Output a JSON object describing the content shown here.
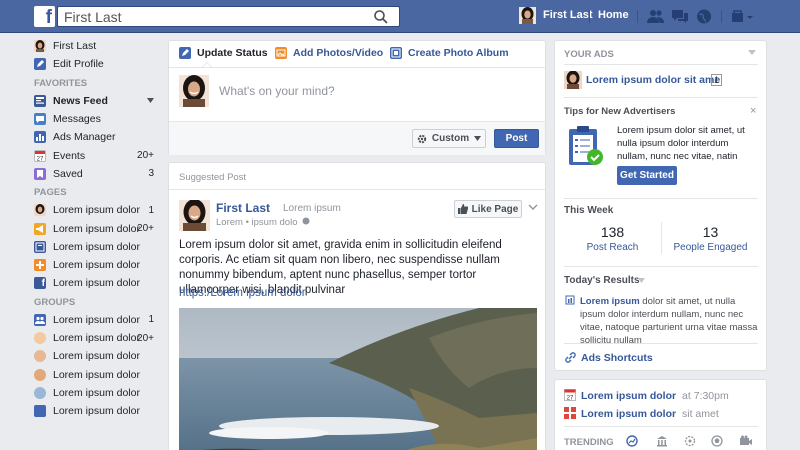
{
  "topbar": {
    "search_placeholder": "First Last",
    "user_name": "First Last",
    "home_label": "Home",
    "icons": [
      "friend-requests-icon",
      "messages-icon",
      "notifications-globe-icon",
      "settings-icon"
    ]
  },
  "left": {
    "profile": {
      "name": "First Last",
      "edit": "Edit Profile"
    },
    "favorites_heading": "FAVORITES",
    "favorites": [
      {
        "label": "News Feed",
        "count": ""
      },
      {
        "label": "Messages",
        "count": ""
      },
      {
        "label": "Ads Manager",
        "count": ""
      },
      {
        "label": "Events",
        "count": "20+"
      },
      {
        "label": "Saved",
        "count": "3"
      }
    ],
    "pages_heading": "PAGES",
    "pages": [
      {
        "label": "Lorem ipsum dolor",
        "count": "1"
      },
      {
        "label": "Lorem ipsum dolor",
        "count": "20+"
      },
      {
        "label": "Lorem ipsum dolor",
        "count": ""
      },
      {
        "label": "Lorem ipsum dolor",
        "count": ""
      },
      {
        "label": "Lorem ipsum dolor",
        "count": ""
      }
    ],
    "groups_heading": "GROUPS",
    "groups": [
      {
        "label": "Lorem ipsum dolor",
        "count": "1"
      },
      {
        "label": "Lorem ipsum dolor",
        "count": "20+"
      },
      {
        "label": "Lorem ipsum dolor",
        "count": ""
      },
      {
        "label": "Lorem ipsum dolor",
        "count": ""
      },
      {
        "label": "Lorem ipsum dolor",
        "count": ""
      },
      {
        "label": "Lorem ipsum dolor",
        "count": ""
      }
    ]
  },
  "composer": {
    "tab_status": "Update Status",
    "tab_photo": "Add Photos/Video",
    "tab_album": "Create Photo Album",
    "placeholder": "What's on your mind?",
    "audience": "Custom",
    "post": "Post"
  },
  "post": {
    "label": "Suggested Post",
    "name": "First Last",
    "handle": "Lorem ipsum",
    "meta": "Lorem • ipsum dolo",
    "like_page": "Like Page",
    "text": "Lorem ipsum dolor sit amet, gravida enim in sollicitudin eleifend corporis. Ac etiam sit quam non libero, nec suspendisse nullam nonummy bibendum, aptent nunc phasellus, semper tortor ullamcorper wisi, blandit pulvinar",
    "link": "https:/Lorem ipsum dolor"
  },
  "right": {
    "your_ads": "YOUR ADS",
    "ad_name": "Lorem ipsum dolor sit ame",
    "ad_count": "1",
    "tips_title": "Tips for New Advertisers",
    "tips_text": "Lorem ipsum dolor sit amet, ut nulla ipsum dolor interdum nullam, nunc nec vitae, natin",
    "get_started": "Get Started",
    "this_week": "This Week",
    "reach_value": "138",
    "reach_label": "Post Reach",
    "engaged_value": "13",
    "engaged_label": "People Engaged",
    "todays_results": "Today's Results",
    "result_bold": "Lorem ipsum",
    "result_text": " dolor sit amet, ut nulla ipsum dolor interdum nullam, nunc nec vitae, natoque parturient urna vitae massa sollicitu nullam",
    "shortcuts": "Ads Shortcuts",
    "events": [
      {
        "title": "Lorem ipsum dolor",
        "detail": "at 7:30pm"
      },
      {
        "title": "Lorem ipsum dolor",
        "detail": "sit amet"
      }
    ],
    "trending": "TRENDING"
  },
  "colors": {
    "topbar": "#4b67a1",
    "link": "#365899",
    "button_primary": "#4267b2",
    "background": "#e9ebee"
  }
}
